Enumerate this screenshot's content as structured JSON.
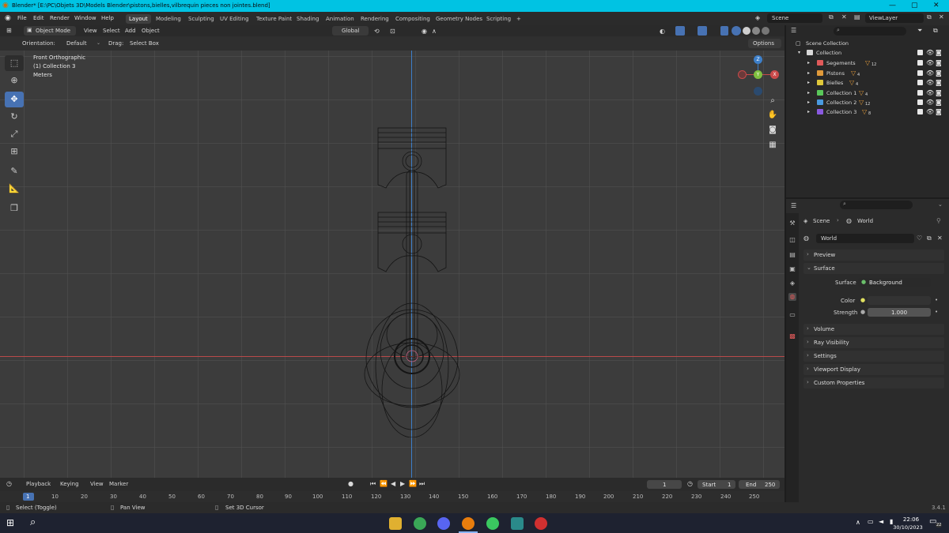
{
  "window": {
    "title": "Blender* [E:\\PC\\Objets 3D\\Models Blender\\pistons,bielles,vilbrequin pieces non jointes.blend]"
  },
  "menubar": {
    "items": [
      "File",
      "Edit",
      "Render",
      "Window",
      "Help"
    ],
    "workspaces": [
      "Layout",
      "Modeling",
      "Sculpting",
      "UV Editing",
      "Texture Paint",
      "Shading",
      "Animation",
      "Rendering",
      "Compositing",
      "Geometry Nodes",
      "Scripting"
    ],
    "add_tab": "+",
    "scene": "Scene",
    "view_layer": "ViewLayer"
  },
  "viewport_header": {
    "mode": "Object Mode",
    "menus": [
      "View",
      "Select",
      "Add",
      "Object"
    ],
    "transform_orientation": "Global",
    "orientation_label": "Orientation:",
    "orientation_value": "Default",
    "drag_label": "Drag:",
    "drag_value": "Select Box",
    "options": "Options"
  },
  "viewport": {
    "view_name": "Front Orthographic",
    "collection": "(1) Collection 3",
    "units": "Meters",
    "gizmo": {
      "z": "Z",
      "x": "X",
      "y": "Y"
    }
  },
  "outliner": {
    "root": "Scene Collection",
    "collection": "Collection",
    "children": [
      {
        "name": "Segements",
        "count": "12",
        "color": "#e05a5a"
      },
      {
        "name": "Pistons",
        "count": "4",
        "color": "#e09a3a"
      },
      {
        "name": "Bielles",
        "count": "4",
        "color": "#e0c83a"
      },
      {
        "name": "Collection 1",
        "count": "4",
        "color": "#5ac85a"
      },
      {
        "name": "Collection 2",
        "count": "12",
        "color": "#4a9ae0"
      },
      {
        "name": "Collection 3",
        "count": "8",
        "color": "#8a5ae0"
      }
    ]
  },
  "properties": {
    "breadcrumb_scene": "Scene",
    "breadcrumb_world": "World",
    "world_name": "World",
    "panels_top": [
      "Preview",
      "Surface"
    ],
    "surface_label": "Surface",
    "surface_value": "Background",
    "color_label": "Color",
    "strength_label": "Strength",
    "strength_value": "1.000",
    "panels_bottom": [
      "Volume",
      "Ray Visibility",
      "Settings",
      "Viewport Display",
      "Custom Properties"
    ]
  },
  "timeline": {
    "menus": [
      "Playback",
      "Keying",
      "View",
      "Marker"
    ],
    "current_frame": "1",
    "start_label": "Start",
    "start_value": "1",
    "end_label": "End",
    "end_value": "250",
    "ticks": [
      "1",
      "10",
      "20",
      "30",
      "40",
      "50",
      "60",
      "70",
      "80",
      "90",
      "100",
      "110",
      "120",
      "130",
      "140",
      "150",
      "160",
      "170",
      "180",
      "190",
      "200",
      "210",
      "220",
      "230",
      "240",
      "250"
    ]
  },
  "statusbar": {
    "hint1": "Select (Toggle)",
    "hint2": "Pan View",
    "hint3": "Set 3D Cursor",
    "version": "3.4.1"
  },
  "taskbar": {
    "time": "22:06",
    "date": "30/10/2023",
    "notifications": "22"
  }
}
